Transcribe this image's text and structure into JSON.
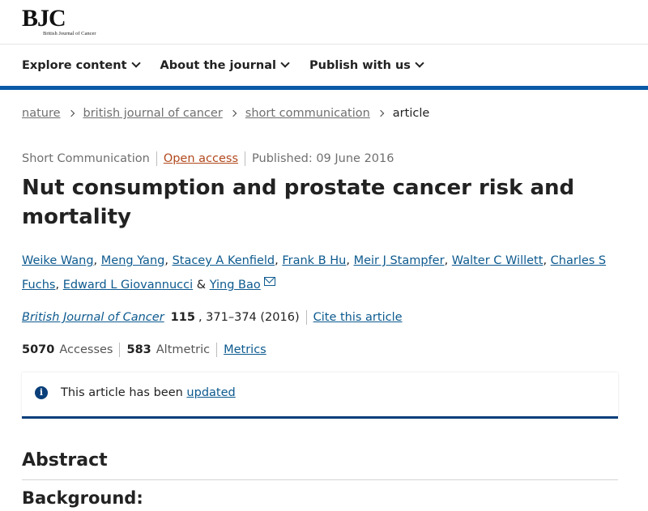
{
  "header": {
    "logo_text": "BJC",
    "logo_sub": "British Journal of Cancer",
    "nav": [
      {
        "label": "Explore content"
      },
      {
        "label": "About the journal"
      },
      {
        "label": "Publish with us"
      }
    ]
  },
  "breadcrumb": [
    "nature",
    "british journal of cancer",
    "short communication",
    "article"
  ],
  "meta": {
    "type": "Short Communication",
    "access": "Open access",
    "published": "Published: 09 June 2016"
  },
  "title": "Nut consumption and prostate cancer risk and mortality",
  "authors": [
    "Weike Wang",
    "Meng Yang",
    "Stacey A Kenfield",
    "Frank B Hu",
    "Meir J Stampfer",
    "Walter C Willett",
    "Charles S Fuchs",
    "Edward L Giovannucci",
    "Ying Bao"
  ],
  "author_sep": ",",
  "author_and": "&",
  "citation": {
    "journal": "British Journal of Cancer",
    "volume": "115",
    "pages": ", 371–374 (2016)",
    "cite_link": "Cite this article"
  },
  "metrics": {
    "accesses_value": "5070",
    "accesses_label": "Accesses",
    "altmetric_value": "583",
    "altmetric_label": "Altmetric",
    "metrics_link": "Metrics"
  },
  "notice": {
    "text": "This article has been",
    "link": "updated"
  },
  "abstract": {
    "heading": "Abstract",
    "sub_heading": "Background:"
  },
  "colors": {
    "brand_blue": "#0a5aa8",
    "link": "#0d5a8f",
    "open_access": "#b1491d"
  }
}
